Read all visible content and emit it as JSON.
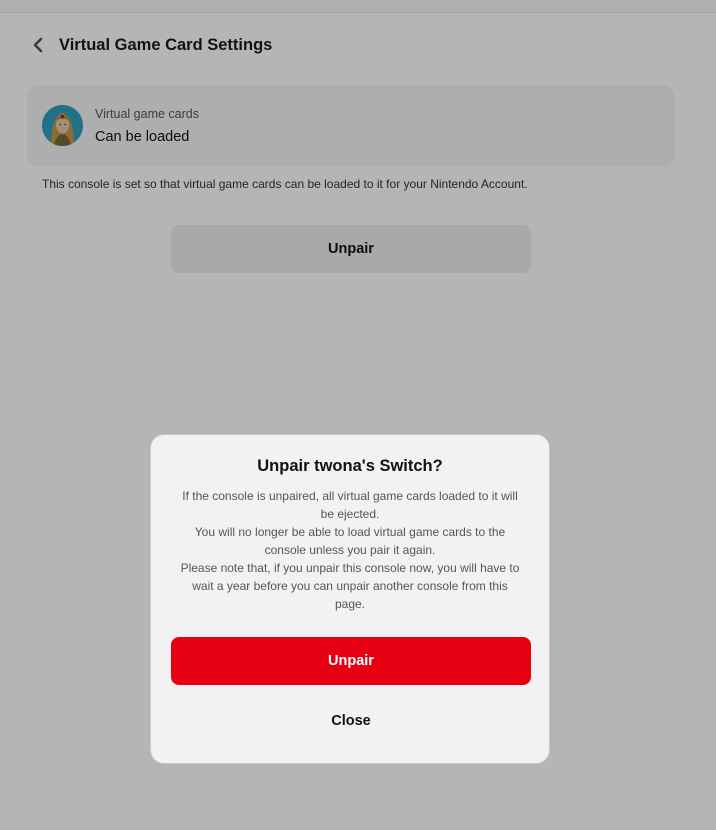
{
  "header": {
    "back_icon": "chevron-left-icon",
    "title": "Virtual Game Card Settings"
  },
  "card": {
    "avatar_icon": "user-avatar",
    "label": "Virtual game cards",
    "value": "Can be loaded"
  },
  "info_text": "This console is set so that virtual game cards can be loaded to it for your Nintendo Account.",
  "unpair_button_label": "Unpair",
  "dialog": {
    "title": "Unpair twona's Switch?",
    "paragraphs": [
      "If the console is unpaired, all virtual game cards loaded to it will be ejected.",
      "You will no longer be able to load virtual game cards to the console unless you pair it again.",
      "Please note that, if you unpair this console now, you will have to wait a year before you can unpair another console from this page."
    ],
    "confirm_label": "Unpair",
    "close_label": "Close"
  },
  "colors": {
    "accent_red": "#e60012",
    "overlay": "rgba(0,0,0,0.29)"
  }
}
